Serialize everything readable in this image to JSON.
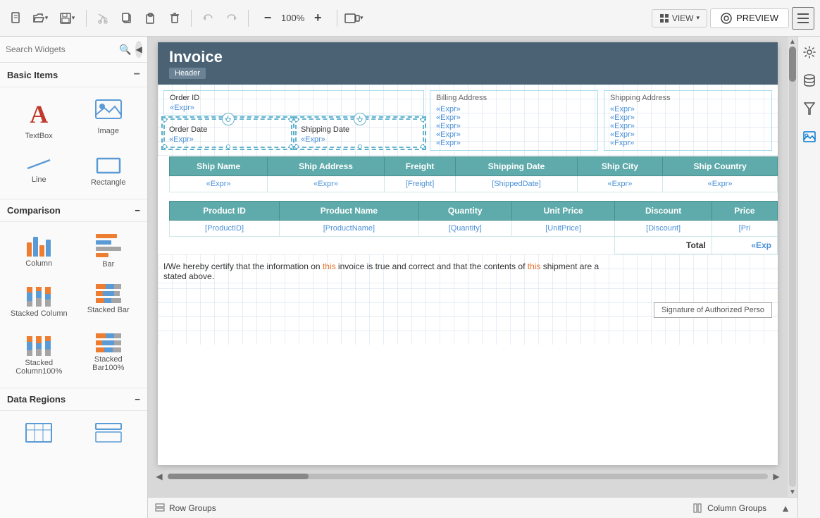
{
  "toolbar": {
    "zoom_level": "100%",
    "view_label": "VIEW",
    "preview_label": "PREVIEW"
  },
  "sidebar": {
    "search_placeholder": "Search Widgets",
    "basic_items_label": "Basic Items",
    "comparison_label": "Comparison",
    "data_regions_label": "Data Regions",
    "widgets": [
      {
        "id": "textbox",
        "label": "TextBox"
      },
      {
        "id": "image",
        "label": "Image"
      },
      {
        "id": "line",
        "label": "Line"
      },
      {
        "id": "rectangle",
        "label": "Rectangle"
      },
      {
        "id": "column",
        "label": "Column"
      },
      {
        "id": "bar",
        "label": "Bar"
      },
      {
        "id": "stacked-column",
        "label": "Stacked Column"
      },
      {
        "id": "stacked-bar",
        "label": "Stacked Bar"
      },
      {
        "id": "stacked-column100",
        "label": "Stacked Column100%"
      },
      {
        "id": "stacked-bar100",
        "label": "Stacked Bar100%"
      }
    ]
  },
  "report": {
    "title": "Invoice",
    "header_band_label": "Header",
    "order_id_label": "Order ID",
    "order_id_expr": "«Expr»",
    "order_date_label": "Order Date",
    "order_date_expr": "«Expr»",
    "shipping_date_label": "Shipping Date",
    "shipping_date_expr": "«Expr»",
    "billing_address_label": "Billing Address",
    "billing_exprs": [
      "«Expr»",
      "«Expr»",
      "«Expr»",
      "«Expr»",
      "«Expr»"
    ],
    "shipping_address_label": "Shipping Address",
    "shipping_exprs": [
      "«Expr»",
      "«Expr»",
      "«Expr»",
      "«Expr»",
      "«Expr»"
    ],
    "ship_columns": [
      {
        "label": "Ship Name"
      },
      {
        "label": "Ship Address"
      },
      {
        "label": "Freight"
      },
      {
        "label": "Shipping Date"
      },
      {
        "label": "Ship City"
      },
      {
        "label": "Ship Country"
      }
    ],
    "ship_data": [
      "«Expr»",
      "«Expr»",
      "[Freight]",
      "[ShippedDate]",
      "«Expr»",
      "«Expr»"
    ],
    "product_columns": [
      {
        "label": "Product ID"
      },
      {
        "label": "Product Name"
      },
      {
        "label": "Quantity"
      },
      {
        "label": "Unit Price"
      },
      {
        "label": "Discount"
      },
      {
        "label": "Price"
      }
    ],
    "product_data": [
      "[ProductID]",
      "[ProductName]",
      "[Quantity]",
      "[UnitPrice]",
      "[Discount]",
      "[Pri"
    ],
    "total_label": "Total",
    "total_expr": "«Exp",
    "cert_text_before": "I/We hereby certify that the information on ",
    "cert_highlight1": "this",
    "cert_text_mid": " invoice is true and correct and that the contents of ",
    "cert_highlight2": "this",
    "cert_text_end": " shipment are as stated above.",
    "signature_label": "Signature of Authorized Perso"
  },
  "bottom_bar": {
    "row_groups_label": "Row Groups",
    "column_groups_label": "Column Groups"
  }
}
